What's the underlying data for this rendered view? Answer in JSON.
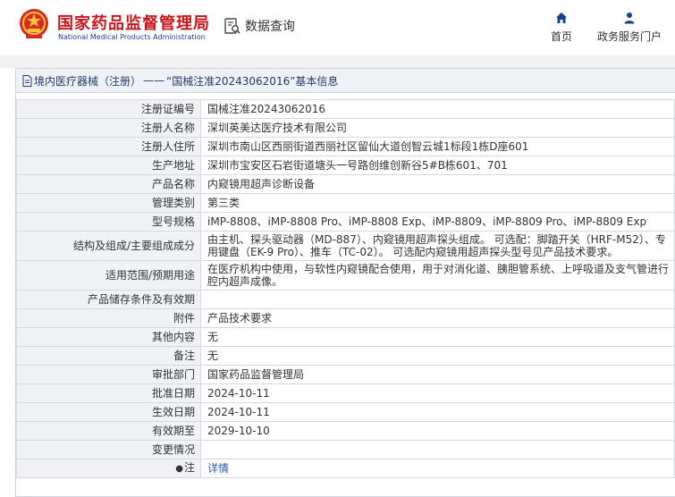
{
  "header": {
    "brand_cn": "国家药品监督管理局",
    "brand_en": "National Medical Products Administration",
    "query_label": "数据查询",
    "nav": [
      {
        "label": "首页",
        "icon": "home-icon"
      },
      {
        "label": "政务服务门户",
        "icon": "user-icon"
      }
    ]
  },
  "breadcrumb": {
    "category": "境内医疗器械（注册）",
    "separator": "——",
    "title": "“国械注准20243062016”基本信息"
  },
  "colors": {
    "brand_red": "#c8161d",
    "brand_blue": "#1a3f8f",
    "label_bg": "#f0f2f5",
    "link": "#2a5db0"
  },
  "rows": [
    {
      "label": "注册证编号",
      "value": "国械注准20243062016"
    },
    {
      "label": "注册人名称",
      "value": "深圳英美达医疗技术有限公司"
    },
    {
      "label": "注册人住所",
      "value": "深圳市南山区西丽街道西丽社区留仙大道创智云城1标段1栋D座601"
    },
    {
      "label": "生产地址",
      "value": "深圳市宝安区石岩街道塘头一号路创维创新谷5#B栋601、701"
    },
    {
      "label": "产品名称",
      "value": "内窥镜用超声诊断设备"
    },
    {
      "label": "管理类别",
      "value": "第三类"
    },
    {
      "label": "型号规格",
      "value": "iMP-8808、iMP-8808 Pro、iMP-8808 Exp、iMP-8809、iMP-8809 Pro、iMP-8809 Exp"
    },
    {
      "label": "结构及组成/主要组成成分",
      "value": "由主机、探头驱动器（MD-887）、内窥镜用超声探头组成。 可选配：脚踏开关（HRF-M52）、专用键盘（EK-9 Pro）、推车（TC-02）。 可选配内窥镜用超声探头型号见产品技术要求。"
    },
    {
      "label": "适用范围/预期用途",
      "value": "在医疗机构中使用，与软性内窥镜配合使用，用于对消化道、胰胆管系统、上呼吸道及支气管进行腔内超声成像。"
    },
    {
      "label": "产品储存条件及有效期",
      "value": ""
    },
    {
      "label": "附件",
      "value": "产品技术要求"
    },
    {
      "label": "其他内容",
      "value": "无"
    },
    {
      "label": "备注",
      "value": "无"
    },
    {
      "label": "审批部门",
      "value": "国家药品监督管理局"
    },
    {
      "label": "批准日期",
      "value": "2024-10-11"
    },
    {
      "label": "生效日期",
      "value": "2024-10-11"
    },
    {
      "label": "有效期至",
      "value": "2029-10-10"
    },
    {
      "label": "变更情况",
      "value": ""
    },
    {
      "label": "注",
      "value": "详情",
      "label_icon": "pin-icon"
    }
  ]
}
